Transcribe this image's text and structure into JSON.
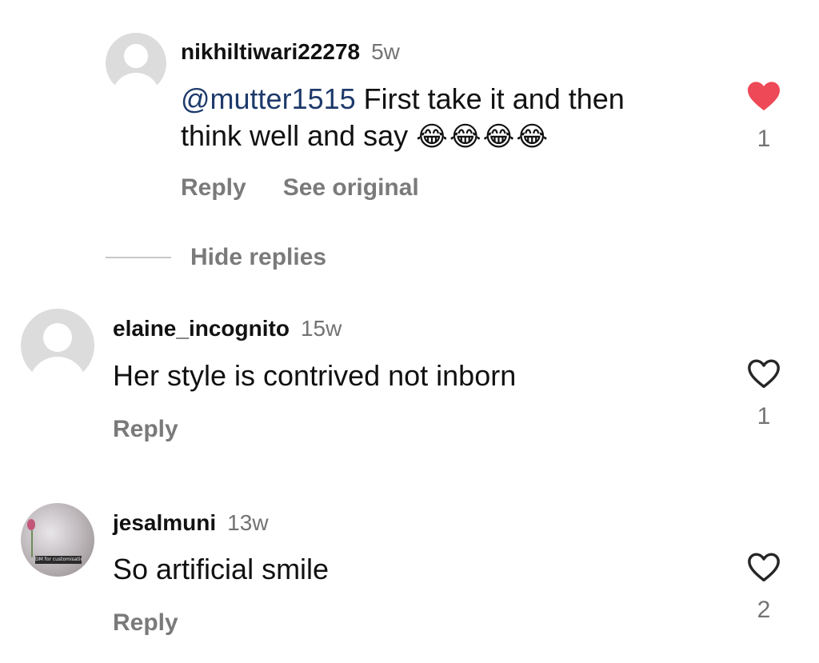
{
  "comments": [
    {
      "username": "nikhiltiwari22278",
      "time": "5w",
      "mention": "@mutter1515",
      "text_line1": " First take it and then",
      "text_line2": "think well and say",
      "emojis": [
        "😂",
        "😂",
        "😂",
        "😂"
      ],
      "reply_label": "Reply",
      "see_original_label": "See original",
      "liked": true,
      "like_count": "1",
      "avatar": "default-avatar"
    },
    {
      "username": "elaine_incognito",
      "time": "15w",
      "text": "Her style is contrived not inborn",
      "reply_label": "Reply",
      "liked": false,
      "like_count": "1",
      "avatar": "default-avatar"
    },
    {
      "username": "jesalmuni",
      "time": "13w",
      "text": "So artificial smile",
      "reply_label": "Reply",
      "liked": false,
      "like_count": "2",
      "avatar": "photo-avatar",
      "avatar_tag": "DM for customisations"
    }
  ],
  "hide_replies_label": "Hide replies",
  "colors": {
    "like_red": "#ed4956",
    "secondary_text": "#737373",
    "mention": "#1e3a6b"
  }
}
